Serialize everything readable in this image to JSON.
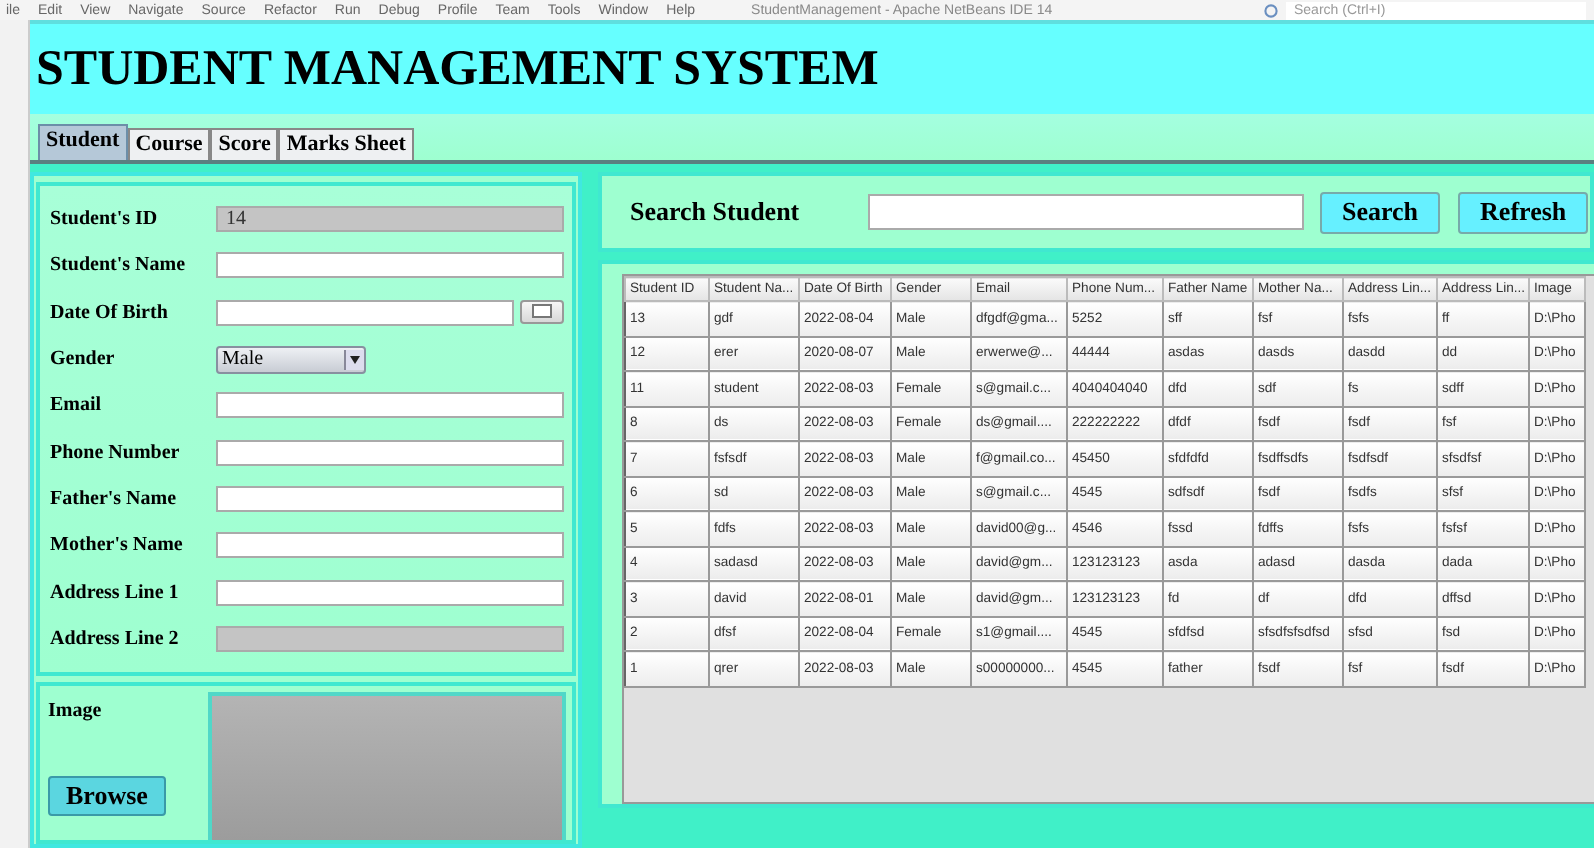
{
  "ide": {
    "menus": [
      "ile",
      "Edit",
      "View",
      "Navigate",
      "Source",
      "Refactor",
      "Run",
      "Debug",
      "Profile",
      "Team",
      "Tools",
      "Window",
      "Help"
    ],
    "title": "StudentManagement - Apache NetBeans IDE 14",
    "search_placeholder": "Search (Ctrl+I)"
  },
  "window": {
    "title": "STUDENT MANAGEMENT SYSTEM"
  },
  "tabs": [
    {
      "label": "Student",
      "selected": true
    },
    {
      "label": "Course",
      "selected": false
    },
    {
      "label": "Score",
      "selected": false
    },
    {
      "label": "Marks Sheet",
      "selected": false
    }
  ],
  "form": {
    "fields": [
      {
        "label": "Student's ID",
        "kind": "text",
        "value": "14",
        "disabled": true
      },
      {
        "label": "Student's Name",
        "kind": "text",
        "disabled": false
      },
      {
        "label": "Date Of Birth",
        "kind": "date",
        "disabled": false
      },
      {
        "label": "Gender",
        "kind": "select",
        "value": "Male",
        "disabled": false
      },
      {
        "label": "Email",
        "kind": "text",
        "disabled": false
      },
      {
        "label": "Phone Number",
        "kind": "text",
        "disabled": false
      },
      {
        "label": "Father's Name",
        "kind": "text",
        "disabled": false
      },
      {
        "label": "Mother's Name",
        "kind": "text",
        "disabled": false
      },
      {
        "label": "Address Line 1",
        "kind": "text",
        "disabled": false
      },
      {
        "label": "Address Line 2",
        "kind": "text",
        "disabled": true
      }
    ],
    "image": {
      "label": "Image",
      "button": "Browse"
    }
  },
  "search": {
    "label": "Search Student",
    "buttons": [
      "Search",
      "Refresh"
    ]
  },
  "table": {
    "columns": [
      "Student ID",
      "Student Na...",
      "Date Of Birth",
      "Gender",
      "Email",
      "Phone Num...",
      "Father Name",
      "Mother Na...",
      "Address Lin...",
      "Address Lin...",
      "Image"
    ],
    "rows": [
      [
        "13",
        "gdf",
        "2022-08-04",
        "Male",
        "dfgdf@gma...",
        "5252",
        "sff",
        "fsf",
        "fsfs",
        "ff",
        "D:\\Pho"
      ],
      [
        "12",
        "erer",
        "2020-08-07",
        "Male",
        "erwerwe@...",
        "44444",
        "asdas",
        "dasds",
        "dasdd",
        "dd",
        "D:\\Pho"
      ],
      [
        "11",
        "student",
        "2022-08-03",
        "Female",
        "s@gmail.c...",
        "4040404040",
        "dfd",
        "sdf",
        "fs",
        "sdff",
        "D:\\Pho"
      ],
      [
        "8",
        "ds",
        "2022-08-03",
        "Female",
        "ds@gmail....",
        "222222222",
        "dfdf",
        "fsdf",
        "fsdf",
        "fsf",
        "D:\\Pho"
      ],
      [
        "7",
        "fsfsdf",
        "2022-08-03",
        "Male",
        "f@gmail.co...",
        "45450",
        "sfdfdfd",
        "fsdffsdfs",
        "fsdfsdf",
        "sfsdfsf",
        "D:\\Pho"
      ],
      [
        "6",
        "sd",
        "2022-08-03",
        "Male",
        "s@gmail.c...",
        "4545",
        "sdfsdf",
        "fsdf",
        "fsdfs",
        "sfsf",
        "D:\\Pho"
      ],
      [
        "5",
        "fdfs",
        "2022-08-03",
        "Male",
        "david00@g...",
        "4546",
        "fssd",
        "fdffs",
        "fsfs",
        "fsfsf",
        "D:\\Pho"
      ],
      [
        "4",
        "sadasd",
        "2022-08-03",
        "Male",
        "david@gm...",
        "123123123",
        "asda",
        "adasd",
        "dasda",
        "dada",
        "D:\\Pho"
      ],
      [
        "3",
        "david",
        "2022-08-01",
        "Male",
        "david@gm...",
        "123123123",
        "fd",
        "df",
        "dfd",
        "dffsd",
        "D:\\Pho"
      ],
      [
        "2",
        "dfsf",
        "2022-08-04",
        "Female",
        "s1@gmail....",
        "4545",
        "sfdfsd",
        "sfsdfsfsdfsd",
        "sfsd",
        "fsd",
        "D:\\Pho"
      ],
      [
        "1",
        "qrer",
        "2022-08-03",
        "Male",
        "s00000000...",
        "4545",
        "father",
        "fsdf",
        "fsf",
        "fsdf",
        "D:\\Pho"
      ]
    ]
  }
}
